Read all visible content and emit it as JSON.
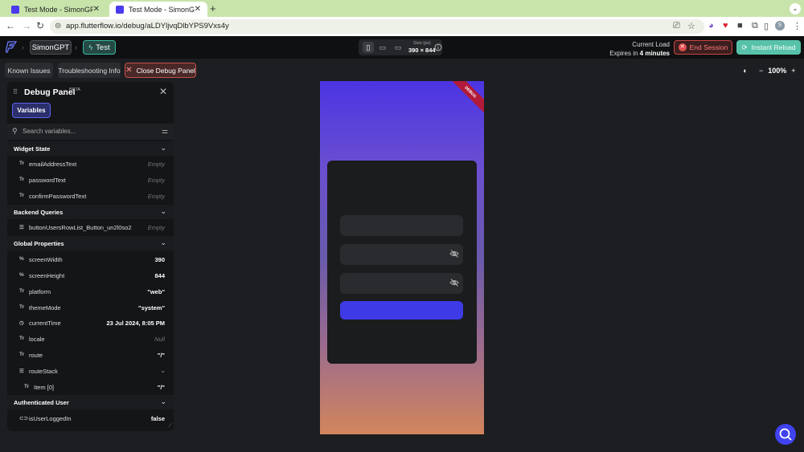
{
  "browser": {
    "tabs": [
      {
        "title": "Test Mode - SimonGPT",
        "active": false
      },
      {
        "title": "Test Mode - SimonGPT",
        "active": true
      }
    ],
    "url": "app.flutterflow.io/debug/aLDYljvqDlbYPS9Vxs4y",
    "profile_initial": "S"
  },
  "appbar": {
    "project_name": "SimonGPT",
    "mode_label": "Test",
    "size_label": "Size (px)",
    "size_value": "390 × 844",
    "current_load": "Current Load",
    "expires_prefix": "Expires in",
    "expires_value": "4 minutes",
    "end_session": "End Session",
    "instant_reload": "Instant Reload"
  },
  "toolbar": {
    "known_issues": "Known Issues",
    "troubleshooting": "Troubleshooting Info",
    "close_debug": "Close Debug Panel",
    "zoom": "100%"
  },
  "debug_panel": {
    "title": "Debug Panel",
    "badge": "BETA",
    "tab_variables": "Variables",
    "search_placeholder": "Search variables...",
    "sections": [
      {
        "title": "Widget State",
        "rows": [
          {
            "icon": "Tr?",
            "name": "emailAddressText",
            "value": "Empty",
            "empty": true
          },
          {
            "icon": "Tr?",
            "name": "passwordText",
            "value": "Empty",
            "empty": true
          },
          {
            "icon": "Tr?",
            "name": "confirmPasswordText",
            "value": "Empty",
            "empty": true
          }
        ]
      },
      {
        "title": "Backend Queries",
        "rows": [
          {
            "icon": "list",
            "name": "buttonUsersRowList_Button_un2l0so2",
            "value": "Empty",
            "empty": true
          }
        ]
      },
      {
        "title": "Global Properties",
        "rows": [
          {
            "icon": "%",
            "name": "screenWidth",
            "value": "390"
          },
          {
            "icon": "%",
            "name": "screenHeight",
            "value": "844"
          },
          {
            "icon": "Tr",
            "name": "platform",
            "value": "\"web\""
          },
          {
            "icon": "Tr",
            "name": "themeMode",
            "value": "\"system\""
          },
          {
            "icon": "clock",
            "name": "currentTime",
            "value": "23 Jul 2024, 8:05 PM"
          },
          {
            "icon": "Tr?",
            "name": "locale",
            "value": "Null",
            "empty": true
          },
          {
            "icon": "Tr",
            "name": "route",
            "value": "\"/\""
          },
          {
            "icon": "list",
            "name": "routeStack",
            "value": "",
            "expandable": true
          },
          {
            "icon": "Tr",
            "name": "Item [0]",
            "value": "\"/\"",
            "indent": true
          }
        ]
      },
      {
        "title": "Authenticated User",
        "rows": [
          {
            "icon": "toggle",
            "name": "isUserLoggedIn",
            "value": "false"
          }
        ]
      }
    ]
  },
  "preview": {
    "debug_ribbon": "DEBUG"
  },
  "colors": {
    "accent": "#4b39ef",
    "reload": "#57c2a9",
    "danger": "#c94545",
    "submit": "#3d3ae6"
  }
}
